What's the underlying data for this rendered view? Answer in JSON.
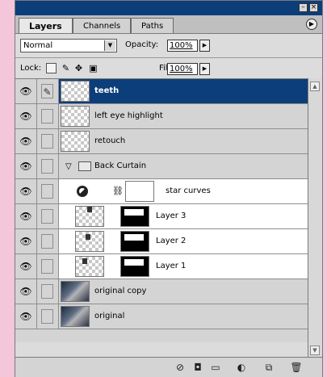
{
  "tabs": [
    {
      "label": "Layers",
      "active": true
    },
    {
      "label": "Channels",
      "active": false
    },
    {
      "label": "Paths",
      "active": false
    }
  ],
  "blend_mode": "Normal",
  "opacity_label": "Opacity:",
  "opacity_value": "100%",
  "lock_label": "Lock:",
  "fill_label": "Fill:",
  "fill_value": "100%",
  "layers": [
    {
      "name": "teeth",
      "selected": true
    },
    {
      "name": "left eye highlight"
    },
    {
      "name": "retouch"
    },
    {
      "name": "Back Curtain",
      "type": "group"
    },
    {
      "name": "star curves",
      "type": "adjustment"
    },
    {
      "name": "Layer 3",
      "type": "masked"
    },
    {
      "name": "Layer 2",
      "type": "masked"
    },
    {
      "name": "Layer 1",
      "type": "masked"
    },
    {
      "name": "original copy",
      "type": "photo"
    },
    {
      "name": "original",
      "type": "photo"
    }
  ],
  "icons": {
    "eye": "eye-icon",
    "brush": "brush-icon",
    "chain": "chain-icon",
    "folder": "folder-icon",
    "menu": "panel-menu-icon"
  },
  "colors": {
    "selection": "#0c3e7a",
    "titlebar": "#0c3e7a"
  }
}
